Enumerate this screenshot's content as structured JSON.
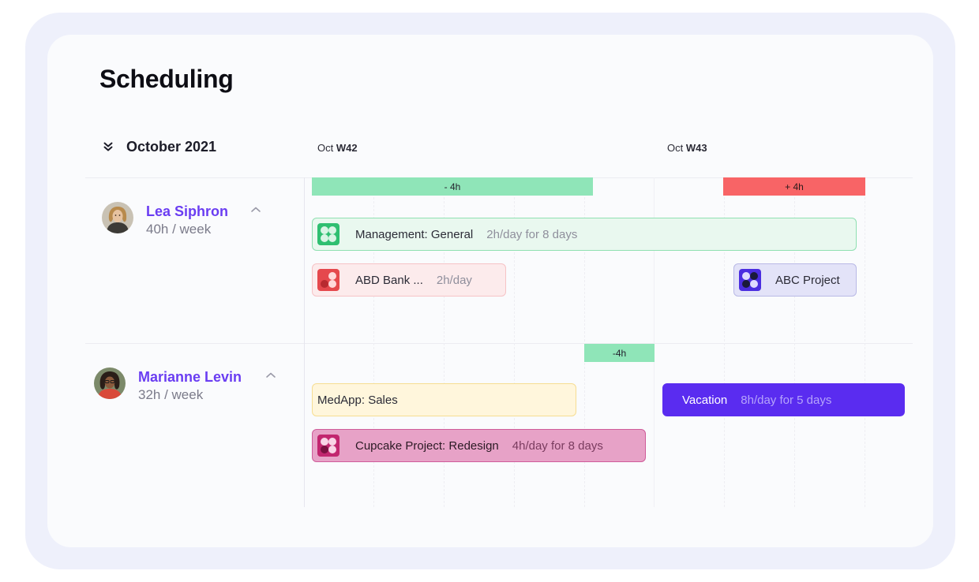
{
  "page": {
    "title": "Scheduling"
  },
  "header": {
    "month": "October 2021",
    "weeks": [
      {
        "month": "Oct",
        "week": "W42"
      },
      {
        "month": "Oct",
        "week": "W43"
      }
    ]
  },
  "people": [
    {
      "name": "Lea Siphron",
      "hours": "40h / week",
      "capacity": [
        {
          "label": "- 4h",
          "status": "under",
          "color": "#8fe5b8"
        },
        {
          "label": "+ 4h",
          "status": "over",
          "color": "#f86466"
        }
      ],
      "tasks": [
        {
          "name": "Management: General",
          "duration": "2h/day for 8 days",
          "icon": "team-icon",
          "color": "#2fbf71"
        },
        {
          "name": "ABD Bank ...",
          "duration": "2h/day",
          "icon": "dots-icon",
          "color": "#e5484d"
        },
        {
          "name": "ABC Project",
          "duration": "",
          "icon": "dots-icon",
          "color": "#4b2de0"
        }
      ]
    },
    {
      "name": "Marianne Levin",
      "hours": "32h / week",
      "capacity": [
        {
          "label": "-4h",
          "status": "under",
          "color": "#8fe5b8"
        }
      ],
      "tasks": [
        {
          "name": "MedApp: Sales",
          "duration": "",
          "icon": "",
          "color": "#f6dd92"
        },
        {
          "name": "Vacation",
          "duration": "8h/day for 5 days",
          "icon": "",
          "color": "#5a2cf0"
        },
        {
          "name": "Cupcake Project: Redesign",
          "duration": "4h/day for 8 days",
          "icon": "dots-icon",
          "color": "#c2266f"
        }
      ]
    }
  ]
}
